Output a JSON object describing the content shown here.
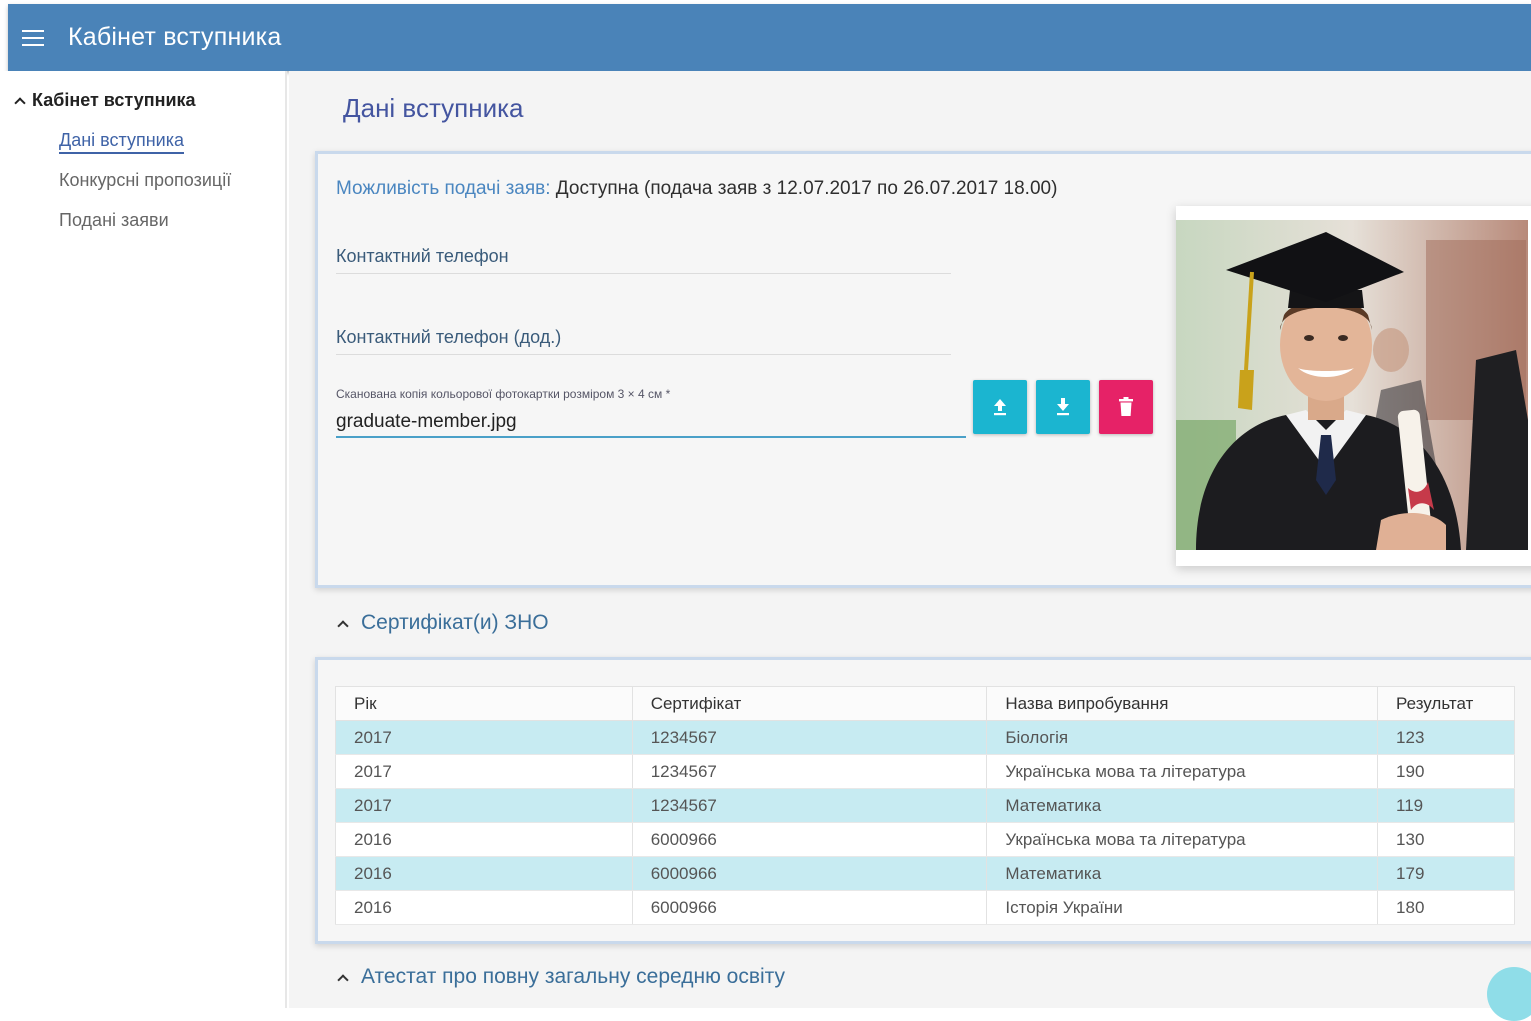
{
  "header": {
    "title": "Кабінет вступника",
    "menu_icon": "hamburger-icon"
  },
  "sidebar": {
    "group_label": "Кабінет вступника",
    "items": [
      {
        "label": "Дані вступника",
        "active": true
      },
      {
        "label": "Конкурсні пропозиції",
        "active": false
      },
      {
        "label": "Подані заяви",
        "active": false
      }
    ]
  },
  "main": {
    "title": "Дані вступника",
    "availability": {
      "label": "Можливість подачі заяв:",
      "value": "Доступна (подача заяв з 12.07.2017 по 26.07.2017 18.00)"
    },
    "phone_label": "Контактний телефон",
    "phone2_label": "Контактний телефон (дод.)",
    "photo_caption": "Сканована копія кольорової фотокартки розміром 3 × 4 см *",
    "photo_file": "graduate-member.jpg",
    "buttons": {
      "upload_icon": "upload-icon",
      "download_icon": "download-icon",
      "delete_icon": "trash-icon"
    }
  },
  "certificates": {
    "section_title": "Сертифікат(и) ЗНО",
    "columns": [
      "Рік",
      "Сертифікат",
      "Назва випробування",
      "Результат"
    ],
    "rows": [
      [
        "2017",
        "1234567",
        "Біологія",
        "123"
      ],
      [
        "2017",
        "1234567",
        "Українська мова та література",
        "190"
      ],
      [
        "2017",
        "1234567",
        "Математика",
        "119"
      ],
      [
        "2016",
        "6000966",
        "Українська мова та література",
        "130"
      ],
      [
        "2016",
        "6000966",
        "Математика",
        "179"
      ],
      [
        "2016",
        "6000966",
        "Історія України",
        "180"
      ]
    ]
  },
  "attestat": {
    "section_title": "Атестат про повну загальну середню освіту"
  },
  "colors": {
    "header": "#4a83b8",
    "accent": "#1bb5d0",
    "danger": "#e62267",
    "row_highlight": "#c7ebf2"
  }
}
